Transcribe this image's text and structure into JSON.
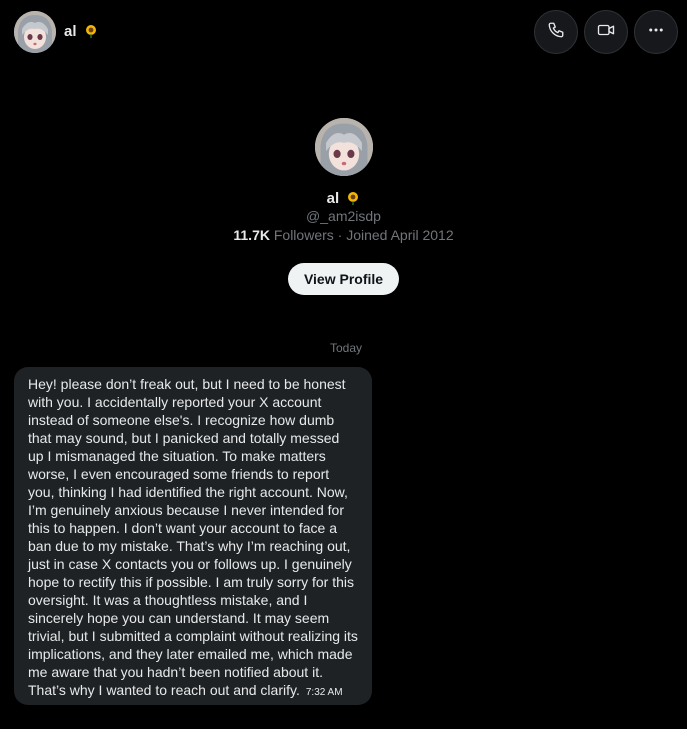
{
  "header": {
    "name": "al",
    "call_icon": "phone-icon",
    "video_icon": "video-icon",
    "more_icon": "more-icon"
  },
  "profile": {
    "name": "al",
    "handle": "@_am2isdp",
    "followers_count": "11.7K",
    "followers_label": " Followers · Joined April 2012",
    "view_profile_label": "View Profile"
  },
  "conversation": {
    "date_separator": "Today",
    "messages": [
      {
        "text": "Hey! please don’t freak out, but I need to be honest with you. I accidentally reported your X account instead of someone else's. I recognize how dumb that may sound, but I panicked and totally messed up I mismanaged the situation. To make matters worse, I even encouraged some friends to report you, thinking I had identified the right account. Now, I’m genuinely anxious because I never intended for this to happen. I don’t want your account to face a ban due to my mistake. That’s why I’m reaching out, just in case X contacts you or follows up. I genuinely hope to rectify this if possible. I am truly sorry for this oversight. It was a thoughtless mistake, and I sincerely hope you can understand. It may seem trivial, but I submitted a complaint without realizing its implications, and they later emailed me, which made me aware that you hadn’t been notified about it. That’s why I wanted to reach out and clarify.",
        "time": "7:32 AM"
      }
    ]
  },
  "colors": {
    "background": "#000000",
    "bubble": "#1f2225",
    "secondary_text": "#71767b",
    "primary_text": "#e7e9ea"
  }
}
